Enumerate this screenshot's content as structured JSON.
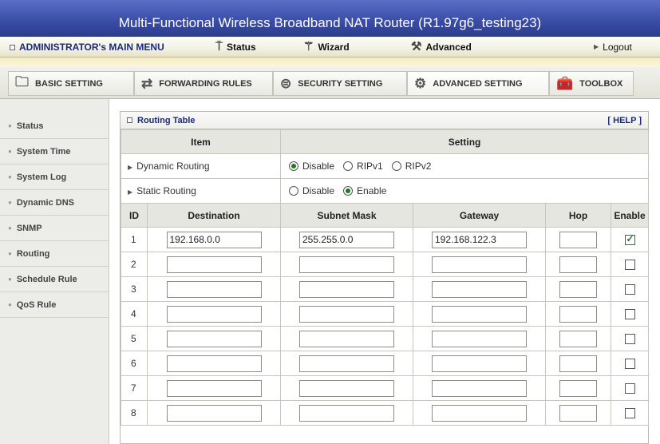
{
  "title": "Multi-Functional Wireless Broadband NAT Router (R1.97g6_testing23)",
  "mainmenu": {
    "admin": "ADMINISTRATOR's MAIN MENU",
    "status": "Status",
    "wizard": "Wizard",
    "advanced": "Advanced",
    "logout": "Logout"
  },
  "tabs": [
    {
      "label": "BASIC SETTING",
      "icon": "folder-icon"
    },
    {
      "label": "FORWARDING RULES",
      "icon": "arrows-icon"
    },
    {
      "label": "SECURITY SETTING",
      "icon": "lock-icon"
    },
    {
      "label": "ADVANCED SETTING",
      "icon": "gear-icon",
      "active": true
    },
    {
      "label": "TOOLBOX",
      "icon": "toolbox-icon"
    }
  ],
  "sidebar": {
    "items": [
      {
        "label": "Status"
      },
      {
        "label": "System Time"
      },
      {
        "label": "System Log"
      },
      {
        "label": "Dynamic DNS"
      },
      {
        "label": "SNMP"
      },
      {
        "label": "Routing"
      },
      {
        "label": "Schedule Rule"
      },
      {
        "label": "QoS Rule"
      }
    ]
  },
  "panel": {
    "title": "Routing Table",
    "help": "[ HELP ]",
    "col_item": "Item",
    "col_setting": "Setting",
    "dynamic_routing": {
      "label": "Dynamic Routing",
      "options": [
        "Disable",
        "RIPv1",
        "RIPv2"
      ],
      "selected": "Disable"
    },
    "static_routing": {
      "label": "Static Routing",
      "options": [
        "Disable",
        "Enable"
      ],
      "selected": "Enable"
    },
    "columns": {
      "id": "ID",
      "destination": "Destination",
      "subnet": "Subnet Mask",
      "gateway": "Gateway",
      "hop": "Hop",
      "enable": "Enable"
    },
    "rows": [
      {
        "id": "1",
        "destination": "192.168.0.0",
        "subnet": "255.255.0.0",
        "gateway": "192.168.122.3",
        "hop": "",
        "enabled": true
      },
      {
        "id": "2",
        "destination": "",
        "subnet": "",
        "gateway": "",
        "hop": "",
        "enabled": false
      },
      {
        "id": "3",
        "destination": "",
        "subnet": "",
        "gateway": "",
        "hop": "",
        "enabled": false
      },
      {
        "id": "4",
        "destination": "",
        "subnet": "",
        "gateway": "",
        "hop": "",
        "enabled": false
      },
      {
        "id": "5",
        "destination": "",
        "subnet": "",
        "gateway": "",
        "hop": "",
        "enabled": false
      },
      {
        "id": "6",
        "destination": "",
        "subnet": "",
        "gateway": "",
        "hop": "",
        "enabled": false
      },
      {
        "id": "7",
        "destination": "",
        "subnet": "",
        "gateway": "",
        "hop": "",
        "enabled": false
      },
      {
        "id": "8",
        "destination": "",
        "subnet": "",
        "gateway": "",
        "hop": "",
        "enabled": false
      }
    ]
  }
}
